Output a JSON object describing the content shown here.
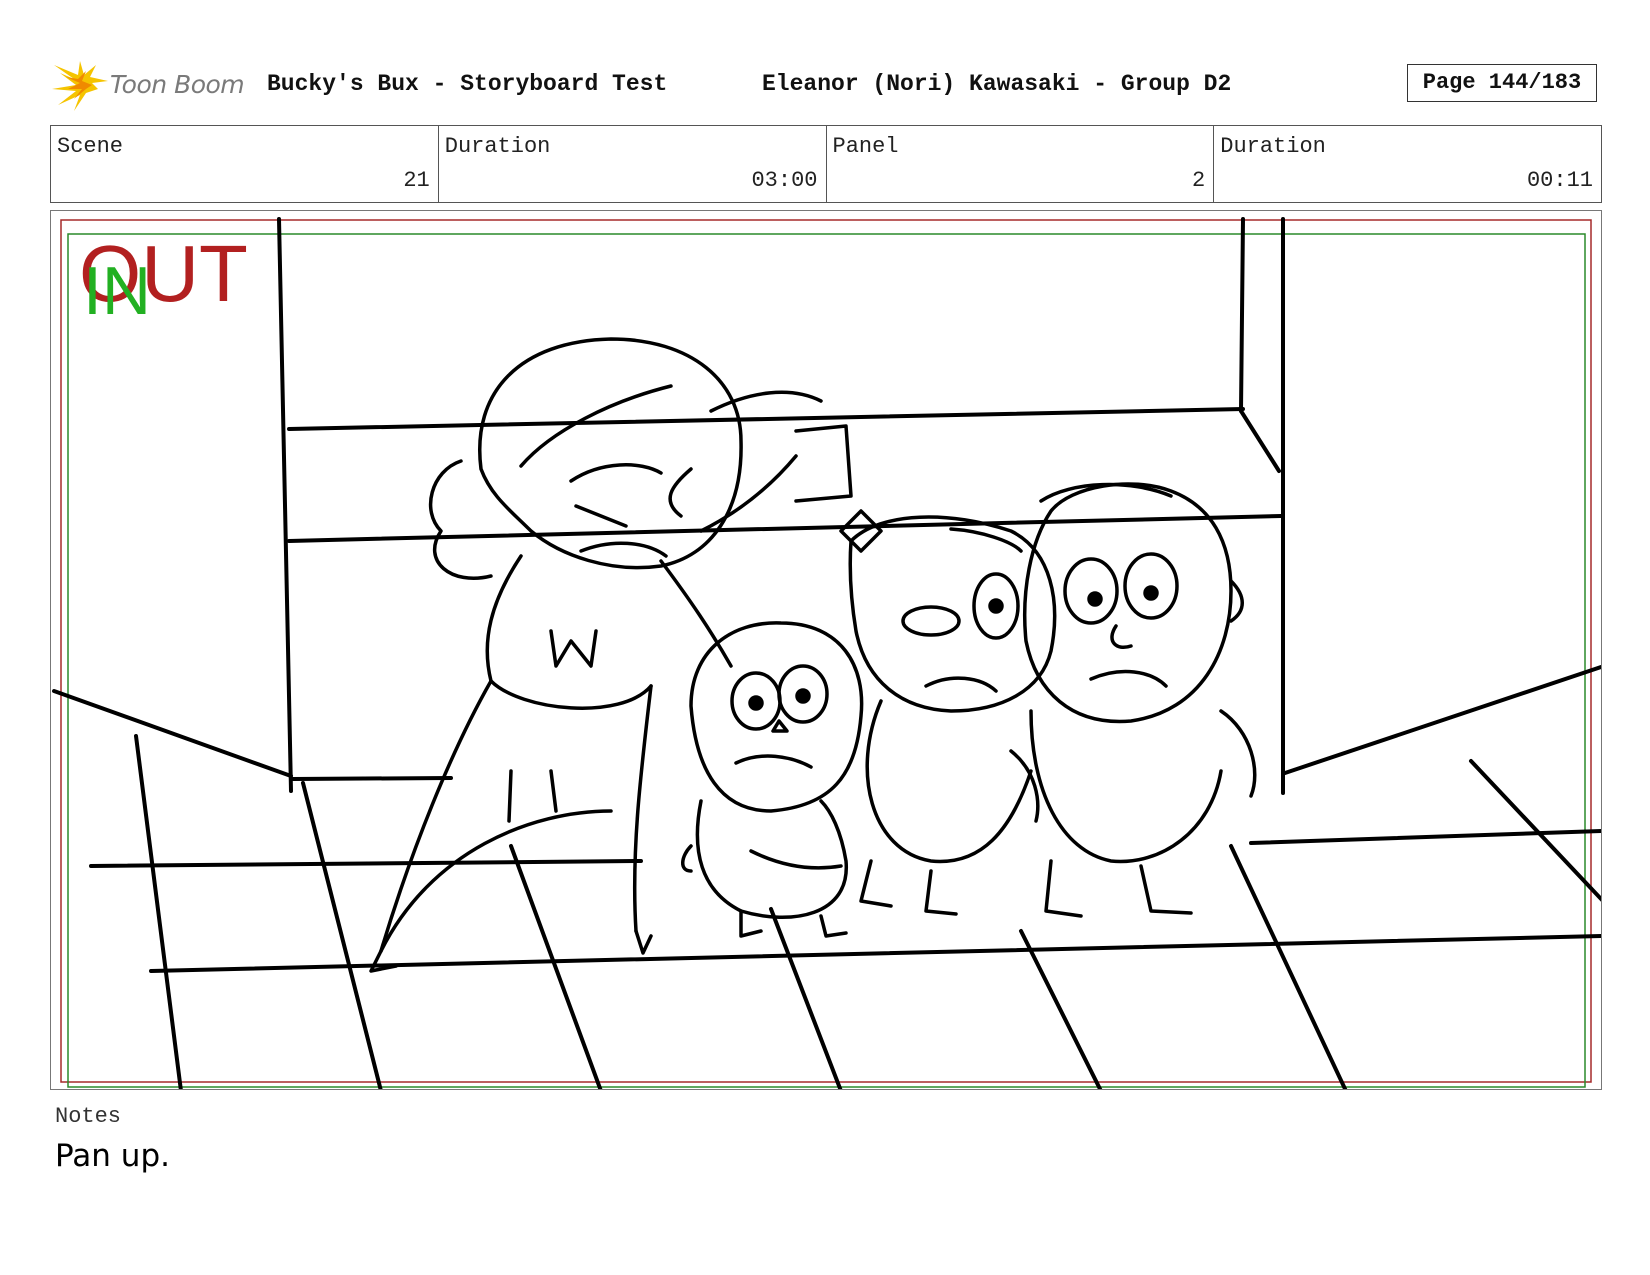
{
  "header": {
    "logo_text": "Toon Boom",
    "title": "Bucky's Bux - Storyboard Test",
    "artist": "Eleanor (Nori) Kawasaki - Group D2",
    "page": "Page 144/183"
  },
  "info": {
    "scene_label": "Scene",
    "scene_value": "21",
    "scene_duration_label": "Duration",
    "scene_duration_value": "03:00",
    "panel_label": "Panel",
    "panel_value": "2",
    "panel_duration_label": "Duration",
    "panel_duration_value": "00:11"
  },
  "frame": {
    "out_label": "OUT",
    "in_label": "IN",
    "out_color": "#b22020",
    "in_color": "#22b022"
  },
  "notes": {
    "label": "Notes",
    "text": "Pan up."
  }
}
